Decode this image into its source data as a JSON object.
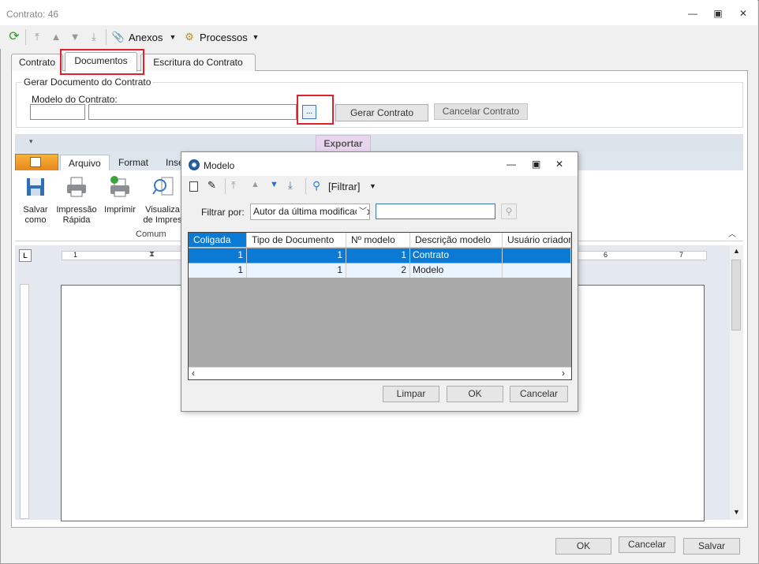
{
  "window": {
    "title": "Contrato: 46"
  },
  "toolbar": {
    "anexos": "Anexos",
    "processos": "Processos"
  },
  "tabs": [
    {
      "label": "Contrato"
    },
    {
      "label": "Documentos"
    },
    {
      "label": "Escritura do Contrato"
    }
  ],
  "form": {
    "group_title": "Gerar Documento do Contrato",
    "model_label": "Modelo do Contrato:",
    "code_value": "",
    "name_value": "",
    "browse_label": "...",
    "generate_label": "Gerar Contrato",
    "cancel_generate_label": "Cancelar Contrato"
  },
  "ribbon": {
    "context_tab": "Exportar",
    "tabs": [
      "Arquivo",
      "Format",
      "Inse"
    ],
    "items": [
      {
        "label": "Salvar\ncomo",
        "icon": "save-icon"
      },
      {
        "label": "Impressão\nRápida",
        "icon": "printer-icon"
      },
      {
        "label": "Imprimir",
        "icon": "print-icon"
      },
      {
        "label": "Visualiza\nde Impres",
        "icon": "preview-icon"
      }
    ],
    "group_label": "Comum",
    "ruler_left": "1",
    "ruler_right_6": "6",
    "ruler_right_7": "7"
  },
  "footer": {
    "ok": "OK",
    "cancel": "Cancelar",
    "save": "Salvar"
  },
  "modal": {
    "title": "Modelo",
    "filter_button": "[Filtrar]",
    "filter_by_label": "Filtrar por:",
    "filter_by_value": "Autor da última modificação",
    "search_value": "",
    "columns": [
      "Coligada",
      "Tipo de Documento",
      "Nº modelo",
      "Descrição modelo",
      "Usuário criador do"
    ],
    "rows": [
      {
        "coligada": "1",
        "tipo": "1",
        "numero": "1",
        "descricao": "Contrato",
        "usuario": ""
      },
      {
        "coligada": "1",
        "tipo": "1",
        "numero": "2",
        "descricao": "Modelo",
        "usuario": ""
      }
    ],
    "clear_button": "Limpar",
    "ok_button": "OK",
    "cancel_button": "Cancelar"
  },
  "colors": {
    "accent": "#0a7ad4",
    "highlight": "#e0202a",
    "arquivo": "#f0a030",
    "export_tab": "#e8d5ee"
  }
}
